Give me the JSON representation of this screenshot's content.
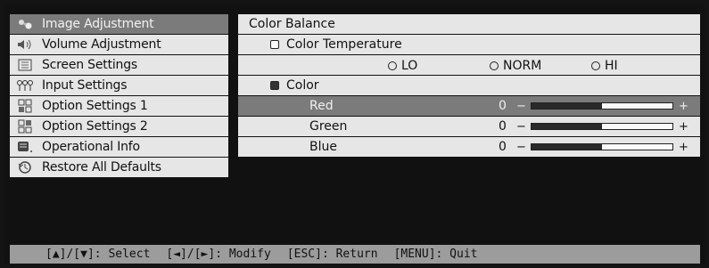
{
  "menu": {
    "items": [
      {
        "label": "Image Adjustment",
        "icon": "image-adjust-icon"
      },
      {
        "label": "Volume Adjustment",
        "icon": "speaker-icon"
      },
      {
        "label": "Screen Settings",
        "icon": "screen-icon"
      },
      {
        "label": "Input Settings",
        "icon": "input-icon"
      },
      {
        "label": "Option Settings 1",
        "icon": "option-icon"
      },
      {
        "label": "Option Settings 2",
        "icon": "option-icon"
      },
      {
        "label": "Operational Info",
        "icon": "info-icon"
      },
      {
        "label": "Restore All Defaults",
        "icon": "restore-icon"
      }
    ]
  },
  "panel": {
    "title": "Color Balance",
    "color_temperature": {
      "label": "Color Temperature",
      "options": [
        "LO",
        "NORM",
        "HI"
      ]
    },
    "color": {
      "label": "Color",
      "channels": [
        {
          "label": "Red",
          "value": "0",
          "level": 0.5
        },
        {
          "label": "Green",
          "value": "0",
          "level": 0.5
        },
        {
          "label": "Blue",
          "value": "0",
          "level": 0.5
        }
      ],
      "minus": "−",
      "plus": "+"
    }
  },
  "status": {
    "select": "[▲]/[▼]: Select",
    "modify": "[◄]/[►]: Modify",
    "return": "[ESC]: Return",
    "quit": "[MENU]: Quit"
  }
}
